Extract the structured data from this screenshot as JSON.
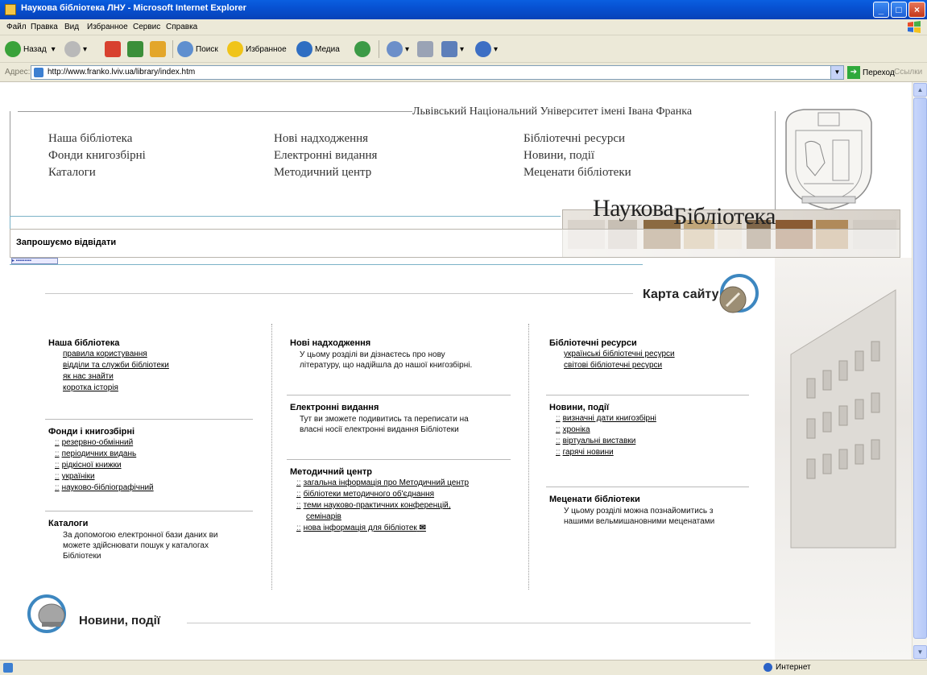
{
  "window": {
    "title": "Наукова бібліотека ЛНУ - Microsoft Internet Explorer"
  },
  "menu": [
    "Файл",
    "Правка",
    "Вид",
    "Избранное",
    "Сервис",
    "Справка"
  ],
  "toolbar": {
    "back": "Назад",
    "search": "Поиск",
    "favorites": "Избранное",
    "media": "Медиа"
  },
  "address": {
    "label": "Адрес:",
    "url": "http://www.franko.lviv.ua/library/index.htm",
    "go": "Переход",
    "links": "Ссылки"
  },
  "status": {
    "zone": "Интернет"
  },
  "page": {
    "university": "Львівський Національний Університет імені Івана Франка",
    "topnav": [
      "Наша бібліотека",
      "Фонди книгозбірні",
      "Каталоги",
      "Нові надходження",
      "Електронні видання",
      "Методичний центр",
      "Бібліотечні ресурси",
      "Новини, події",
      "Меценати бібліотеки"
    ],
    "logo_big": "Наукова",
    "logo_sub": "Бібліотека",
    "banner_label": "Запрошуємо відвідати",
    "sitemap_title": "Карта сайту",
    "col1": {
      "s1_title": "Наша бібліотека",
      "s1_links": [
        "правила користування",
        "відділи та служби бібліотеки",
        "як нас знайти",
        "коротка історія"
      ],
      "s2_title": "Фонди і книгозбірні",
      "s2_links": [
        "резервно-обмінний",
        "періодичних видань",
        "рідкісної книжки",
        "україніки",
        "науково-бібліографічний"
      ],
      "s3_title": "Каталоги",
      "s3_desc": [
        "За допомогою електронної бази даних ви",
        "можете здійснювати пошук у каталогах",
        "Бібліотеки"
      ]
    },
    "col2": {
      "s1_title": "Нові надходження",
      "s1_desc": [
        "У цьому розділі ви дізнаєтесь про нову",
        "літературу, що надійшла до нашої книгозбірні."
      ],
      "s2_title": "Електронні видання",
      "s2_desc": [
        "Тут ви зможете подивитись та переписати на",
        "власні носії електронні видання Бібліотеки"
      ],
      "s3_title": "Методичний центр",
      "s3_links": [
        "загальна інформація про Методичний центр",
        "бібліотеки методичного об'єднання",
        "теми науково-практичних конференцій,",
        "семінарів",
        "нова інформація для бібліотек"
      ]
    },
    "col3": {
      "s1_title": "Бібліотечні ресурси",
      "s1_links": [
        "українські бібліотечні ресурси",
        "світові бібліотечні ресурси"
      ],
      "s2_title": "Новини, події",
      "s2_links": [
        "визначні дати книгозбірні",
        "хроніка",
        "віртуальні виставки",
        "гарячі новини"
      ],
      "s3_title": "Меценати бібліотеки",
      "s3_desc": [
        "У цьому розділі можна познайомитись з",
        "нашими вельмишановними меценатами"
      ]
    },
    "news_title": "Новини, події"
  }
}
